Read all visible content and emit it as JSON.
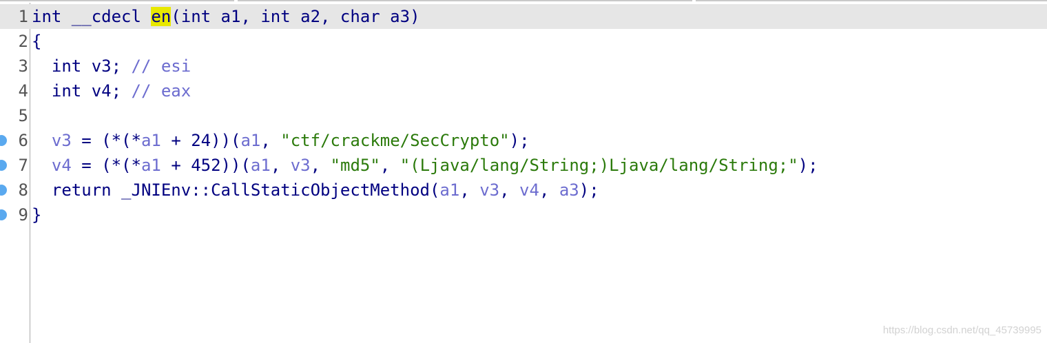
{
  "editor": {
    "lines": [
      {
        "number": "1",
        "breakpoint": false,
        "current": true,
        "tokens": [
          {
            "t": "int __cdecl ",
            "c": "kw"
          },
          {
            "t": "en",
            "c": "hl"
          },
          {
            "t": "(int a1, int a2, char a3)",
            "c": "kw"
          }
        ]
      },
      {
        "number": "2",
        "breakpoint": false,
        "current": false,
        "tokens": [
          {
            "t": "{",
            "c": "kw"
          }
        ]
      },
      {
        "number": "3",
        "breakpoint": false,
        "current": false,
        "tokens": [
          {
            "t": "  int v3; ",
            "c": "kw"
          },
          {
            "t": "// esi",
            "c": "cmt"
          }
        ]
      },
      {
        "number": "4",
        "breakpoint": false,
        "current": false,
        "tokens": [
          {
            "t": "  int v4; ",
            "c": "kw"
          },
          {
            "t": "// eax",
            "c": "cmt"
          }
        ]
      },
      {
        "number": "5",
        "breakpoint": false,
        "current": false,
        "tokens": []
      },
      {
        "number": "6",
        "breakpoint": true,
        "current": false,
        "tokens": [
          {
            "t": "  ",
            "c": "kw"
          },
          {
            "t": "v3",
            "c": "var"
          },
          {
            "t": " = (*(*",
            "c": "kw"
          },
          {
            "t": "a1",
            "c": "var"
          },
          {
            "t": " + 24))(",
            "c": "kw"
          },
          {
            "t": "a1",
            "c": "var"
          },
          {
            "t": ", ",
            "c": "kw"
          },
          {
            "t": "\"ctf/crackme/SecCrypto\"",
            "c": "str"
          },
          {
            "t": ");",
            "c": "kw"
          }
        ]
      },
      {
        "number": "7",
        "breakpoint": true,
        "current": false,
        "tokens": [
          {
            "t": "  ",
            "c": "kw"
          },
          {
            "t": "v4",
            "c": "var"
          },
          {
            "t": " = (*(*",
            "c": "kw"
          },
          {
            "t": "a1",
            "c": "var"
          },
          {
            "t": " + 452))(",
            "c": "kw"
          },
          {
            "t": "a1",
            "c": "var"
          },
          {
            "t": ", ",
            "c": "kw"
          },
          {
            "t": "v3",
            "c": "var"
          },
          {
            "t": ", ",
            "c": "kw"
          },
          {
            "t": "\"md5\"",
            "c": "str"
          },
          {
            "t": ", ",
            "c": "kw"
          },
          {
            "t": "\"(Ljava/lang/String;)Ljava/lang/String;\"",
            "c": "str"
          },
          {
            "t": ");",
            "c": "kw"
          }
        ]
      },
      {
        "number": "8",
        "breakpoint": true,
        "current": false,
        "tokens": [
          {
            "t": "  return _JNIEnv::CallStaticObjectMethod(",
            "c": "kw"
          },
          {
            "t": "a1",
            "c": "var"
          },
          {
            "t": ", ",
            "c": "kw"
          },
          {
            "t": "v3",
            "c": "var"
          },
          {
            "t": ", ",
            "c": "kw"
          },
          {
            "t": "v4",
            "c": "var"
          },
          {
            "t": ", ",
            "c": "kw"
          },
          {
            "t": "a3",
            "c": "var"
          },
          {
            "t": ");",
            "c": "kw"
          }
        ]
      },
      {
        "number": "9",
        "breakpoint": true,
        "current": false,
        "tokens": [
          {
            "t": "}",
            "c": "kw"
          }
        ]
      }
    ]
  },
  "watermark": "https://blog.csdn.net/qq_45739995",
  "colors": {
    "keyword": "#000080",
    "variable": "#6c6ccf",
    "comment": "#6c6ccf",
    "string": "#2b7a0b",
    "highlight": "#e8e800",
    "current_line": "#e6e6e6",
    "breakpoint": "#5aa9ef"
  }
}
